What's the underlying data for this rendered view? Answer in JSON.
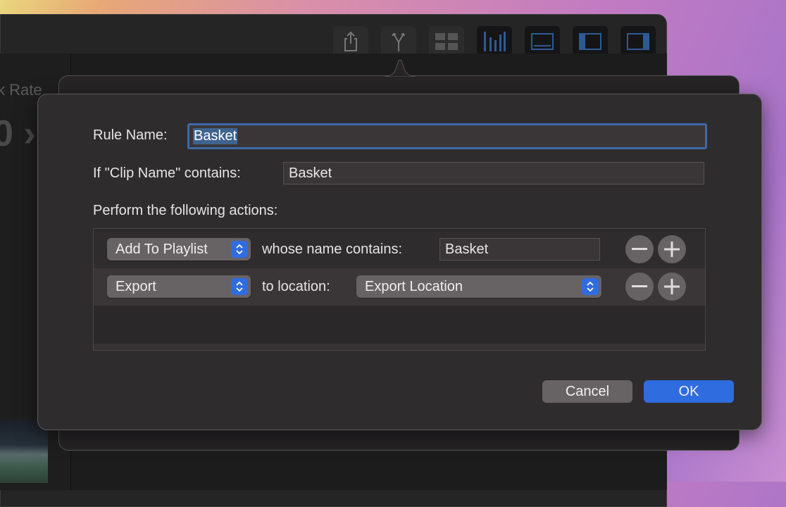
{
  "toolbar": {
    "icons": [
      "share-icon",
      "split-icon",
      "grid-icon",
      "audio-meters-icon",
      "viewer-icon",
      "left-sidebar-icon",
      "right-sidebar-icon"
    ]
  },
  "background_pane": {
    "rate_label": "k Rate",
    "value": "0 ›"
  },
  "dialog": {
    "rule_name_label": "Rule Name:",
    "rule_name_value": "Basket",
    "condition_label": "If \"Clip Name\" contains:",
    "condition_value": "Basket",
    "actions_label": "Perform the following actions:",
    "actions": [
      {
        "action": "Add To Playlist",
        "connector": "whose name contains:",
        "value": "Basket"
      },
      {
        "action": "Export",
        "connector": "to location:",
        "value": "Export Location"
      }
    ],
    "cancel_label": "Cancel",
    "ok_label": "OK"
  },
  "colors": {
    "accent": "#2f6ce0",
    "focus_ring": "#3d6aa8",
    "dialog_bg": "#2f2c2e"
  }
}
